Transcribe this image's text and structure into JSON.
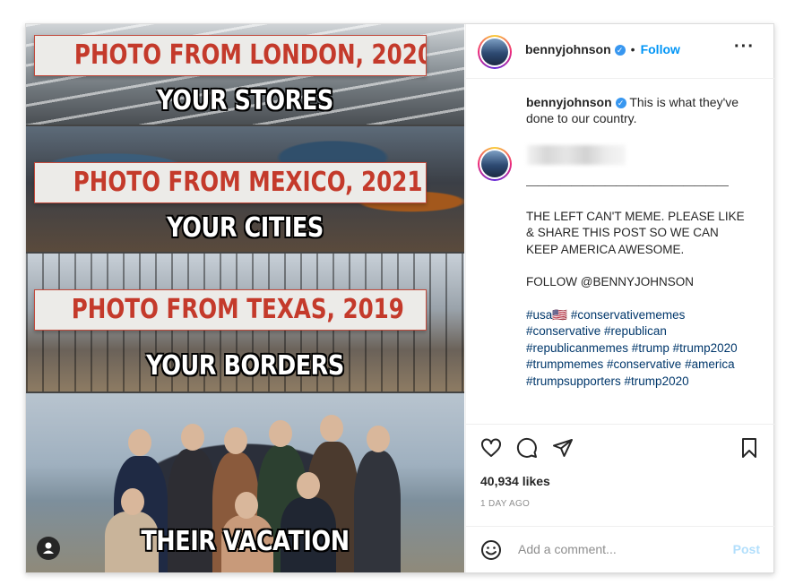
{
  "image": {
    "labels": [
      "PHOTO FROM LONDON, 2020",
      "PHOTO FROM MEXICO, 2021",
      "PHOTO FROM TEXAS, 2019"
    ],
    "captions": [
      "YOUR STORES",
      "YOUR CITIES",
      "YOUR BORDERS",
      "THEIR VACATION"
    ],
    "user_tag_icon": "person-tag-icon"
  },
  "header": {
    "username": "bennyjohnson",
    "verified_icon": "verified-badge-icon",
    "separator": "•",
    "follow_label": "Follow",
    "more_icon": "more-options-icon"
  },
  "caption": {
    "username": "bennyjohnson",
    "text": "This is what they've done to our country.",
    "divider": "——————————————————",
    "lines": [
      "THE LEFT CAN'T MEME. PLEASE LIKE & SHARE THIS POST SO WE CAN KEEP AMERICA AWESOME.",
      "FOLLOW @BENNYJOHNSON"
    ],
    "hashtags": "#usa🇺🇸 #conservativememes #conservative #republican #republicanmemes #trump #trump2020 #trumpmemes #conservative #america #trumpsupporters #trump2020"
  },
  "actions": {
    "like_icon": "heart-icon",
    "comment_icon": "comment-icon",
    "share_icon": "share-icon",
    "save_icon": "bookmark-icon"
  },
  "likes": "40,934 likes",
  "time": "1 DAY AGO",
  "add_comment": {
    "emoji_icon": "emoji-icon",
    "placeholder": "Add a comment...",
    "post_label": "Post"
  },
  "colors": {
    "accent": "#0095f6",
    "label_red": "#c43a2b",
    "hashtag": "#00376b"
  }
}
